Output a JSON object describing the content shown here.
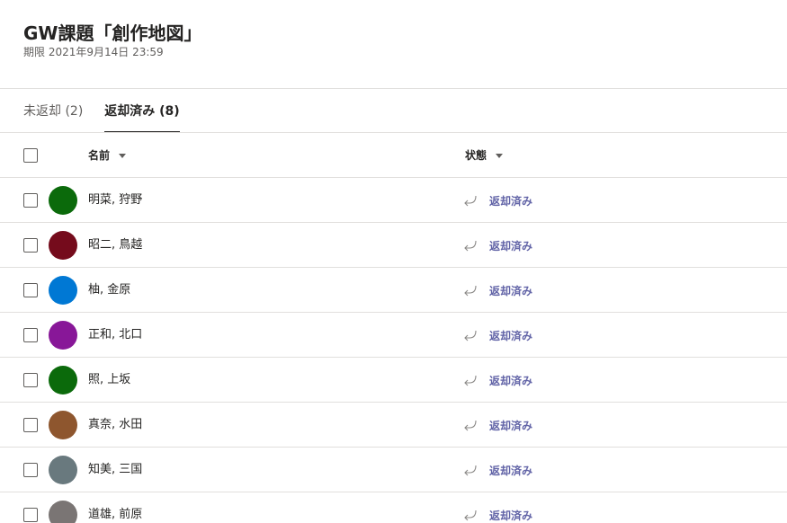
{
  "header": {
    "title": "GW課題「創作地図」",
    "due": "期限 2021年9月14日 23:59"
  },
  "tabs": [
    {
      "label": "未返却 (2)",
      "active": false
    },
    {
      "label": "返却済み (8)",
      "active": true
    }
  ],
  "table": {
    "columns": {
      "name": "名前",
      "status": "状態"
    },
    "rows": [
      {
        "name": "明菜, 狩野",
        "status": "返却済み",
        "avatar_color": "#0b6a0b"
      },
      {
        "name": "昭二, 鳥越",
        "status": "返却済み",
        "avatar_color": "#750b1c"
      },
      {
        "name": "柚, 金原",
        "status": "返却済み",
        "avatar_color": "#0078d4"
      },
      {
        "name": "正和, 北口",
        "status": "返却済み",
        "avatar_color": "#881798"
      },
      {
        "name": "照, 上坂",
        "status": "返却済み",
        "avatar_color": "#0b6a0b"
      },
      {
        "name": "真奈, 水田",
        "status": "返却済み",
        "avatar_color": "#8e562e"
      },
      {
        "name": "知美, 三国",
        "status": "返却済み",
        "avatar_color": "#69797e"
      },
      {
        "name": "道雄, 前原",
        "status": "返却済み",
        "avatar_color": "#7a7574"
      }
    ]
  },
  "icons": {
    "status": "return-arrow-icon",
    "sort": "caret-down-icon"
  },
  "colors": {
    "accent": "#6264a7",
    "text": "#252423",
    "subtle": "#605e5c",
    "divider": "#e1dfdd"
  }
}
